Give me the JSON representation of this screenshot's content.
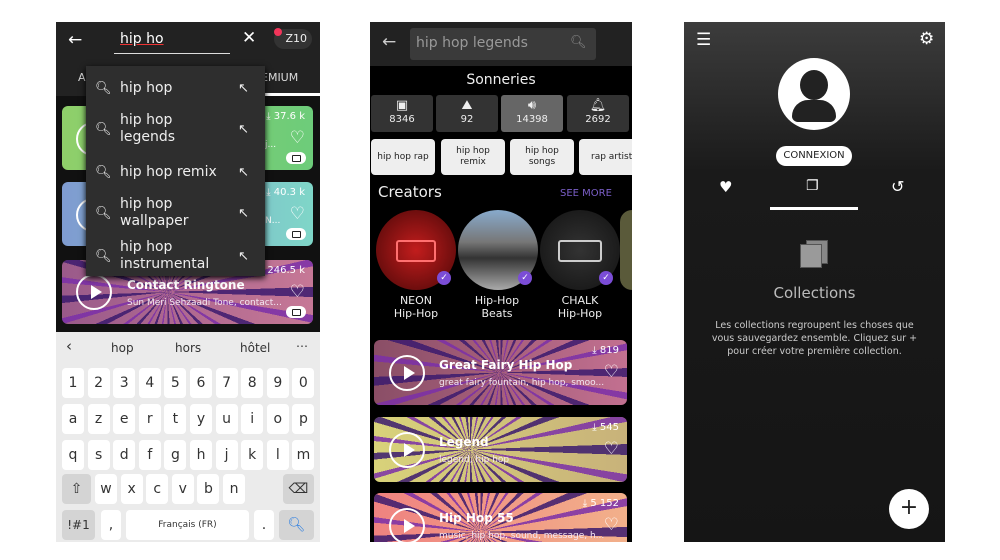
{
  "screen1": {
    "search_value": "hip ho",
    "badge": "Z10",
    "tabs": [
      "A",
      "EMIUM"
    ],
    "suggestions": [
      {
        "line1": "hip hop",
        "line2": ""
      },
      {
        "line1": "hip hop",
        "line2": "legends"
      },
      {
        "line1": "hip hop remix",
        "line2": ""
      },
      {
        "line1": "hip hop",
        "line2": "wallpaper"
      },
      {
        "line1": "hip hop",
        "line2": "instrumental"
      }
    ],
    "cards": [
      {
        "downloads": "37.6 k",
        "subtitle": "j..."
      },
      {
        "downloads": "40.3 k",
        "subtitle": "N..."
      },
      {
        "title": "Contact Ringtone",
        "subtitle": "Sun Meri Sehzaadi Tone, contact...",
        "downloads": "246.5 k"
      }
    ],
    "keyboard": {
      "suggestions": [
        "hop",
        "hors",
        "hôtel"
      ],
      "rows": [
        [
          "1",
          "2",
          "3",
          "4",
          "5",
          "6",
          "7",
          "8",
          "9",
          "0"
        ],
        [
          "a",
          "z",
          "e",
          "r",
          "t",
          "y",
          "u",
          "i",
          "o",
          "p"
        ],
        [
          "q",
          "s",
          "d",
          "f",
          "g",
          "h",
          "j",
          "k",
          "l",
          "m"
        ],
        [
          "w",
          "x",
          "c",
          "v",
          "b",
          "n"
        ]
      ],
      "sym": "!#1",
      "comma": ",",
      "space": "Français (FR)",
      "period": "."
    }
  },
  "screen2": {
    "search_value": "hip hop legends",
    "section": "Sonneries",
    "tiles": [
      {
        "icon": "wallpaper-icon",
        "count": "8346"
      },
      {
        "icon": "live-wallpaper-icon",
        "count": "92"
      },
      {
        "icon": "speaker-icon",
        "count": "14398",
        "active": true
      },
      {
        "icon": "bell-icon",
        "count": "2692"
      }
    ],
    "chips": [
      "hip hop rap",
      "hip hop remix",
      "hip hop songs",
      "rap artist"
    ],
    "creators_title": "Creators",
    "see_more": "SEE MORE",
    "creators": [
      {
        "line1": "NEON",
        "line2": "Hip-Hop"
      },
      {
        "line1": "Hip-Hop",
        "line2": "Beats"
      },
      {
        "line1": "CHALK",
        "line2": "Hip-Hop"
      }
    ],
    "ringtones": [
      {
        "title": "Great Fairy Hip Hop",
        "tags": "great fairy fountain, hip hop, smoo...",
        "downloads": "819",
        "color": "#a6607a"
      },
      {
        "title": "Legend",
        "tags": "legend, hip hop",
        "downloads": "545",
        "color": "#cfc27a"
      },
      {
        "title": "Hip Hop 55",
        "tags": "music, hip hop, sound, message, h...",
        "downloads": "5 152",
        "color": "#ef8f86"
      }
    ],
    "accent": "#7b5fc8"
  },
  "screen3": {
    "login": "CONNEXION",
    "empty_title": "Collections",
    "empty_text": "Les collections regroupent les choses que vous sauvegardez ensemble. Cliquez sur + pour créer votre première collection.",
    "fab": "+"
  }
}
